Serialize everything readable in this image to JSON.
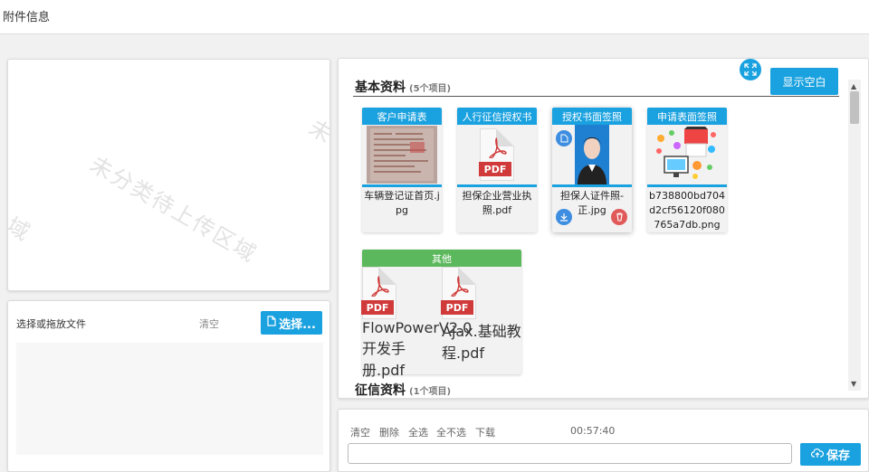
{
  "header": {
    "title": "附件信息"
  },
  "drop_area": {
    "watermark_main": "未分类待上传区域",
    "watermark_right": "未",
    "watermark_left": "域"
  },
  "upload": {
    "label": "选择或拖放文件",
    "clear_label": "清空",
    "select_label": "选择..."
  },
  "files": {
    "show_blank_label": "显示空白",
    "section_title": "基本资料",
    "section_count": "(5个项目)",
    "section2_title": "征信资料",
    "section2_count": "(1个项目)",
    "cards": [
      {
        "category": "客户申请表",
        "filename": "车辆登记证首页.jpg",
        "thumb": "photo-thumbnail"
      },
      {
        "category": "人行征信授权书",
        "filename": "担保企业营业执照.pdf",
        "thumb": "pdf-icon"
      },
      {
        "category": "授权书面签照",
        "filename": "担保人证件照-正.jpg",
        "thumb": "portrait-photo"
      },
      {
        "category": "申请表面签照",
        "filename": "b738800bd704d2cf56120f080765a7db.png",
        "thumb": "illustration"
      }
    ],
    "group": {
      "category": "其他",
      "items": [
        {
          "filename": "FlowPowerV2.0开发手册.pdf",
          "thumb": "pdf-icon"
        },
        {
          "filename": "Ajax.基础教程.pdf",
          "thumb": "pdf-icon"
        }
      ]
    },
    "pdf_tag": "PDF"
  },
  "actions": {
    "clear": "清空",
    "delete": "删除",
    "select_all": "全选",
    "deselect_all": "全不选",
    "download": "下载",
    "time": "00:57:40",
    "save_label": "保存"
  },
  "colors": {
    "accent": "#1aa1df",
    "green": "#5cb85c",
    "pdf_red": "#d03a3a",
    "delete_red": "#e05a5a",
    "download_blue": "#3d8de0"
  }
}
